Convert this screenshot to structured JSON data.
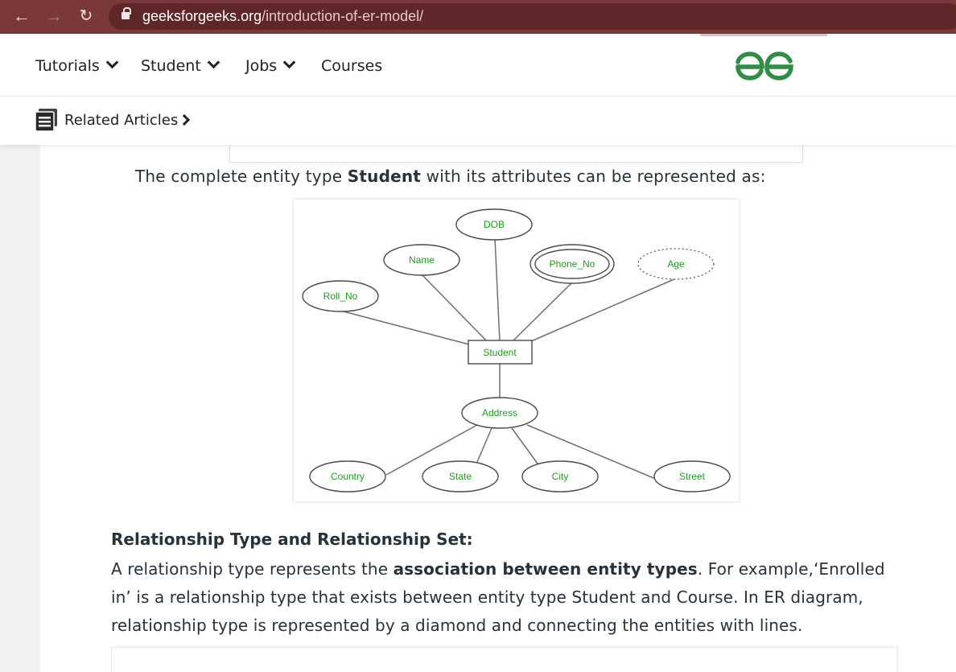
{
  "browser": {
    "back_icon": "arrow-left-icon",
    "forward_icon": "arrow-right-icon",
    "reload_icon": "reload-icon",
    "lock_icon": "lock-icon",
    "url_domain": "geeksforgeeks.org",
    "url_path": "/introduction-of-er-model/",
    "colors": {
      "chrome": "#7b3838",
      "address_bar": "#5f2727"
    }
  },
  "nav": {
    "items": [
      {
        "label": "Tutorials",
        "has_dropdown": true
      },
      {
        "label": "Student",
        "has_dropdown": true
      },
      {
        "label": "Jobs",
        "has_dropdown": true
      },
      {
        "label": "Courses",
        "has_dropdown": false
      }
    ],
    "logo_icon": "gfg-logo-icon",
    "logo_color": "#2f8d46"
  },
  "related": {
    "label": "Related Articles",
    "icon": "document-list-icon",
    "arrow_icon": "chevron-right-icon"
  },
  "article": {
    "intro_prefix": "The complete entity type ",
    "intro_bold": "Student",
    "intro_suffix": " with its attributes can be represented as:",
    "diagram": {
      "entity": "Student",
      "attributes": {
        "dob": "DOB",
        "name": "Name",
        "phone": "Phone_No",
        "age": "Age",
        "roll": "Roll_No",
        "address": "Address",
        "country": "Country",
        "state": "State",
        "city": "City",
        "street": "Street"
      },
      "label_color": "#1aa11a"
    },
    "section_heading": "Relationship Type and Relationship Set:",
    "para_prefix": "A relationship type represents the ",
    "para_bold": "association between entity types",
    "para_suffix": ". For example,‘Enrolled in’ is a relationship type that exists between entity type Student and Course. In ER diagram, relationship type is represented by a diamond and connecting the entities with lines."
  }
}
